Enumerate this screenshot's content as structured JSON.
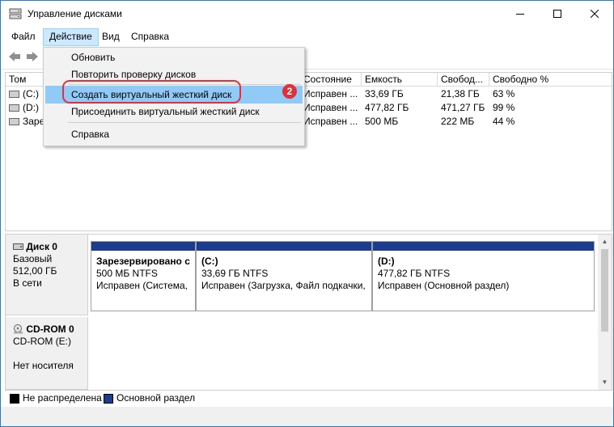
{
  "window": {
    "title": "Управление дисками"
  },
  "menubar": {
    "file": "Файл",
    "action": "Действие",
    "view": "Вид",
    "help": "Справка"
  },
  "volume_table": {
    "columns": [
      "Том",
      "Состояние",
      "Емкость",
      "Свобод...",
      "Свободно %"
    ],
    "rows": [
      {
        "volume": "(C:)",
        "status": "Исправен ...",
        "capacity": "33,69 ГБ",
        "free": "21,38 ГБ",
        "free_pct": "63 %"
      },
      {
        "volume": "(D:)",
        "status": "Исправен ...",
        "capacity": "477,82 ГБ",
        "free": "471,27 ГБ",
        "free_pct": "99 %"
      },
      {
        "volume": "Заре",
        "status": "Исправен ...",
        "capacity": "500 МБ",
        "free": "222 МБ",
        "free_pct": "44 %"
      }
    ]
  },
  "dropdown": {
    "items": [
      "Обновить",
      "Повторить проверку дисков",
      "Создать виртуальный жесткий диск",
      "Присоединить виртуальный жесткий диск",
      "Справка"
    ],
    "badge": "2"
  },
  "disks": [
    {
      "name": "Диск 0",
      "type": "Базовый",
      "size": "512,00 ГБ",
      "state": "В сети",
      "partitions": [
        {
          "name": "Зарезервировано с",
          "size": "500 МБ NTFS",
          "status": "Исправен (Система,"
        },
        {
          "name": "(C:)",
          "size": "33,69 ГБ NTFS",
          "status": "Исправен (Загрузка, Файл подкачки,"
        },
        {
          "name": "(D:)",
          "size": "477,82 ГБ NTFS",
          "status": "Исправен (Основной раздел)"
        }
      ]
    },
    {
      "name": "CD-ROM 0",
      "drive": "CD-ROM (E:)",
      "media": "Нет носителя"
    }
  ],
  "legend": {
    "unallocated": "Не распределена",
    "primary": "Основной раздел"
  },
  "colors": {
    "unallocated": "#000000",
    "primary": "#1b3c8f",
    "highlight": "#91c9f7",
    "callout": "#e0303a"
  }
}
